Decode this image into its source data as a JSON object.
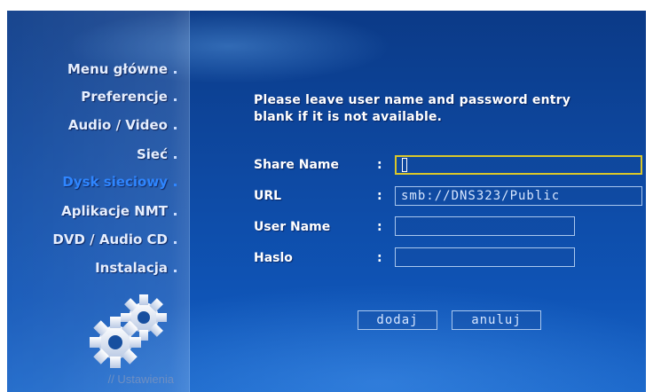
{
  "sidebar": {
    "items": [
      {
        "label": "Menu główne",
        "active": false
      },
      {
        "label": "Preferencje",
        "active": false
      },
      {
        "label": "Audio / Video",
        "active": false
      },
      {
        "label": "Sieć",
        "active": false
      },
      {
        "label": "Dysk sieciowy",
        "active": true
      },
      {
        "label": "Aplikacje NMT",
        "active": false
      },
      {
        "label": "DVD / Audio CD",
        "active": false
      },
      {
        "label": "Instalacja",
        "active": false
      }
    ],
    "section_caption": "// Ustawienia",
    "section_icon": "gears-icon"
  },
  "form": {
    "info_text_line1": "Please leave user name and password entry",
    "info_text_line2": "blank if it is not available.",
    "colon": ":",
    "fields": {
      "share_name": {
        "label": "Share Name",
        "value": "",
        "focused": true
      },
      "url": {
        "label": "URL",
        "value": "smb://DNS323/Public"
      },
      "user_name": {
        "label": "User Name",
        "value": ""
      },
      "password": {
        "label": "Haslo",
        "value": ""
      }
    },
    "buttons": {
      "add": "dodaj",
      "cancel": "anuluj"
    }
  },
  "colors": {
    "active_menu": "#2f86ff",
    "focus_border": "#d9c72a",
    "background": "#0e4aa4"
  }
}
